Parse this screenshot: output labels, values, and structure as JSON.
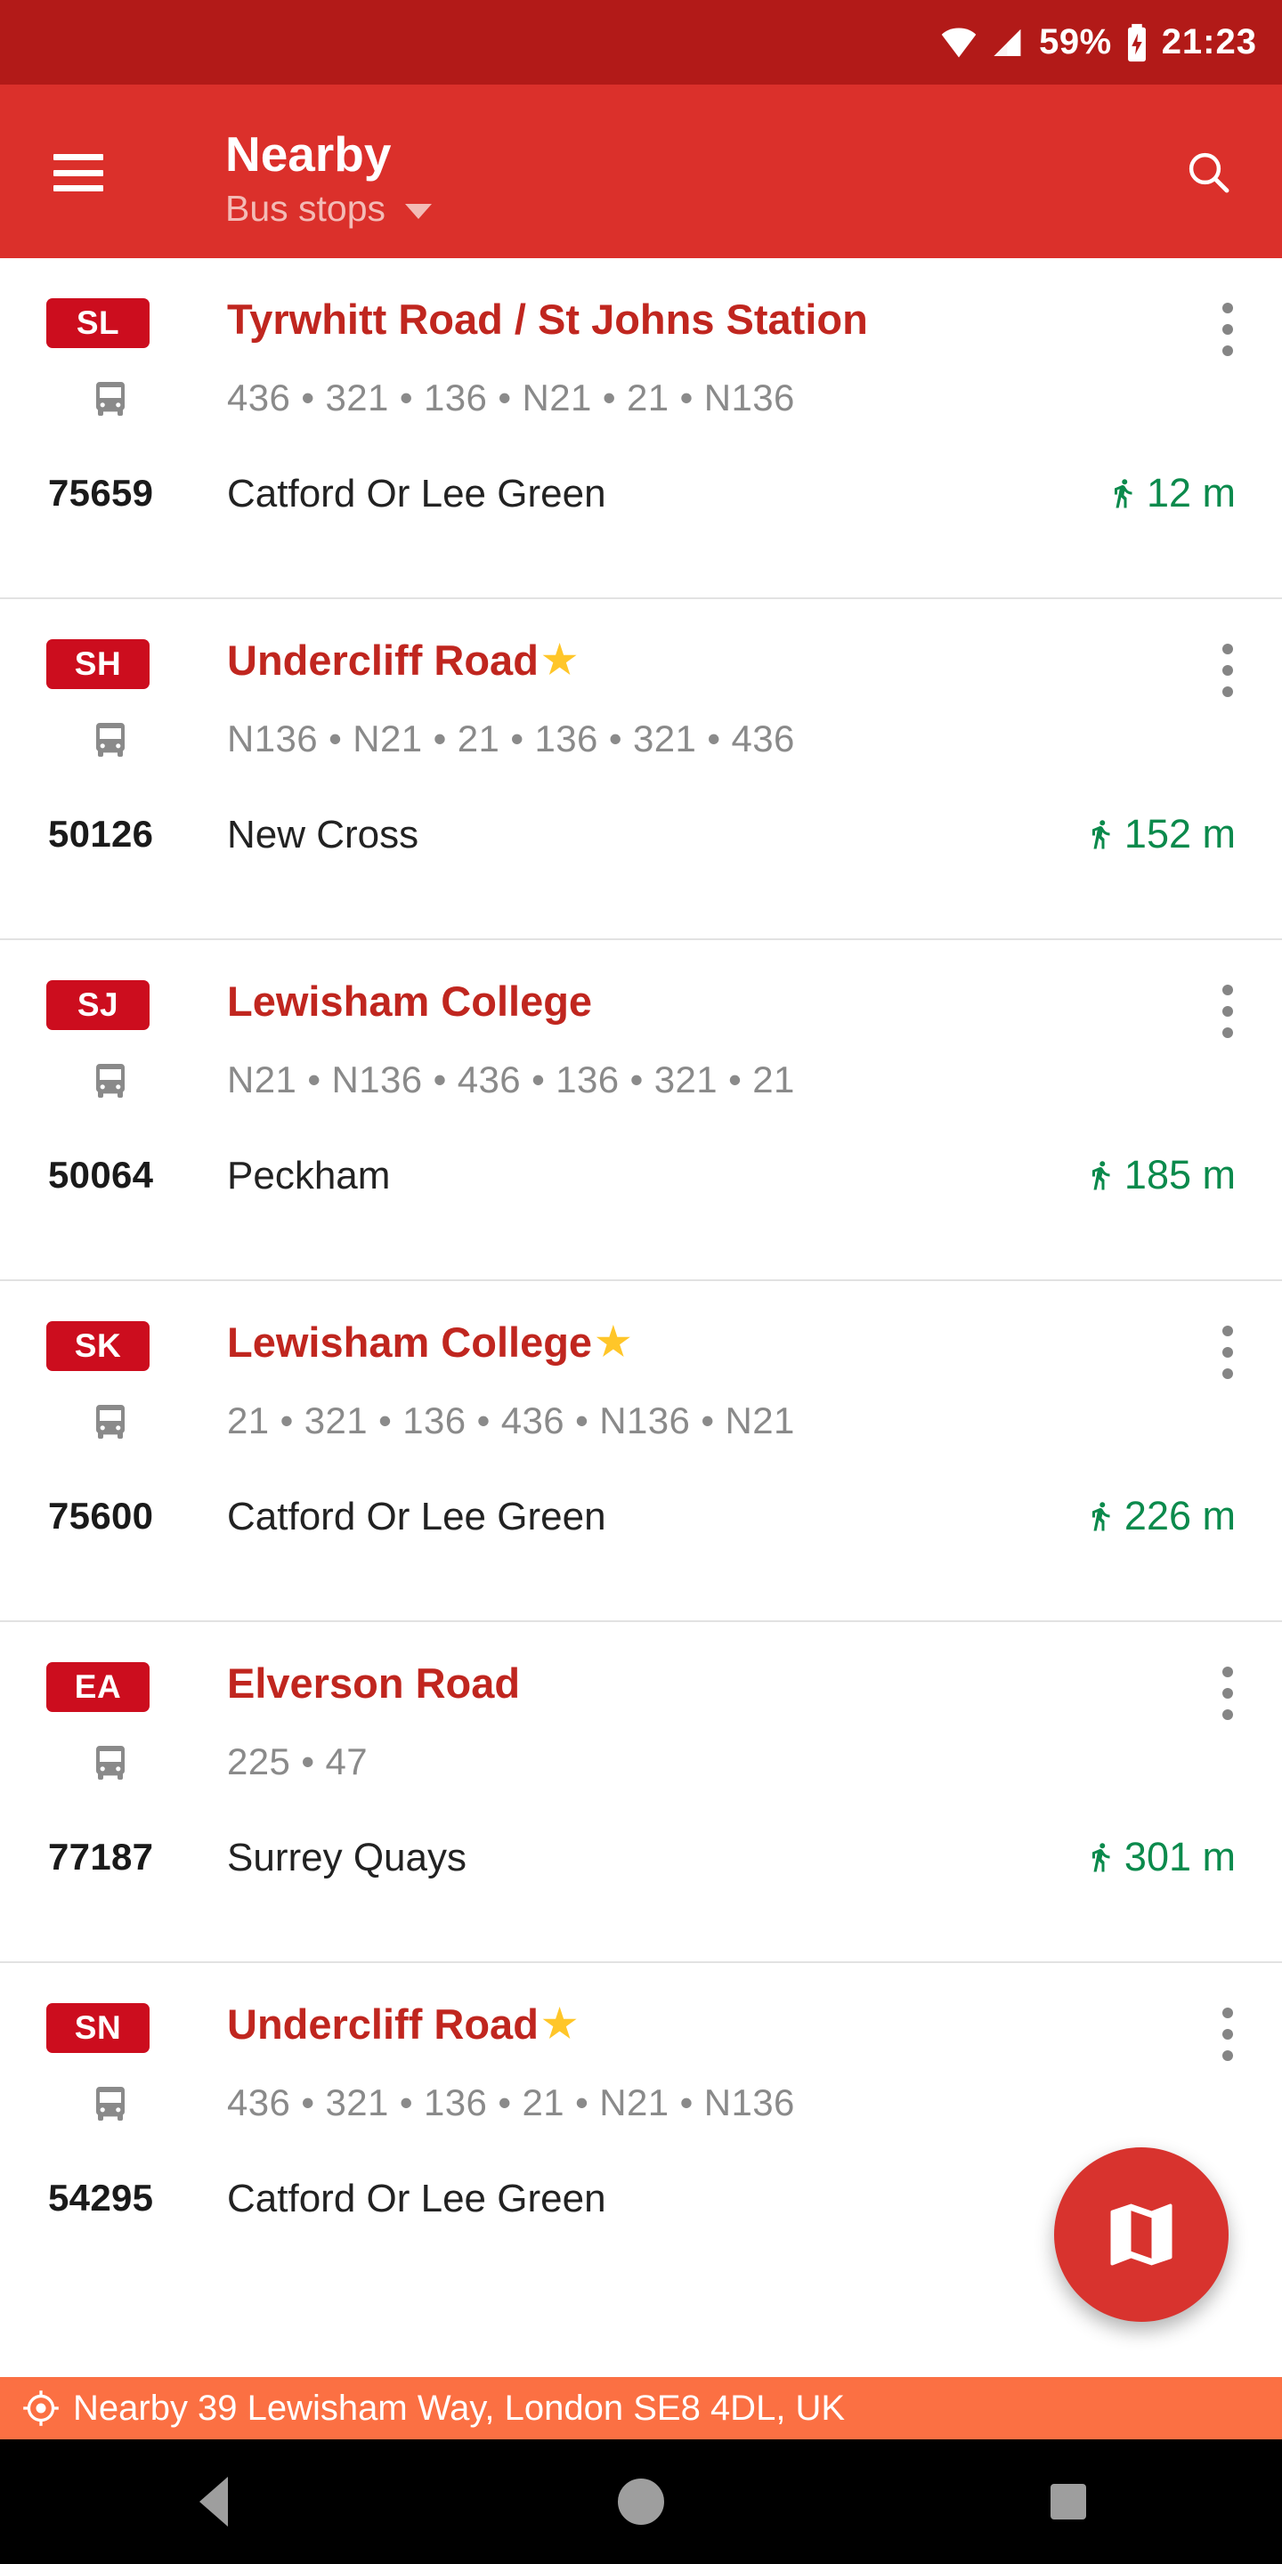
{
  "status_bar": {
    "wifi_icon": "wifi-icon",
    "signal_icon": "cellular-signal-icon",
    "battery_percent": "59%",
    "battery_icon": "battery-charging-icon",
    "time": "21:23"
  },
  "app_bar": {
    "menu_icon": "hamburger-menu-icon",
    "title": "Nearby",
    "subtitle": "Bus stops",
    "dropdown_icon": "chevron-down-icon",
    "search_icon": "search-icon"
  },
  "colors": {
    "status_bar": "#B21A18",
    "app_bar": "#DB302B",
    "badge": "#CC0D1E",
    "stop_name": "#C0261F",
    "distance": "#0B8A4C",
    "routes": "#8A8A8A",
    "location_bar": "#FB7043",
    "fab": "#D8332E",
    "star": "#FFC629"
  },
  "list": {
    "items": [
      {
        "badge": "SL",
        "name": "Tyrwhitt Road / St Johns Station",
        "favourite": false,
        "star": "",
        "routes": "436 • 321 • 136 • N21 • 21 • N136",
        "code": "75659",
        "destination": "Catford Or Lee Green",
        "distance": "12 m"
      },
      {
        "badge": "SH",
        "name": "Undercliff Road",
        "favourite": true,
        "star": "★",
        "routes": "N136 • N21 • 21 • 136 • 321 • 436",
        "code": "50126",
        "destination": "New Cross",
        "distance": "152 m"
      },
      {
        "badge": "SJ",
        "name": "Lewisham College",
        "favourite": false,
        "star": "",
        "routes": "N21 • N136 • 436 • 136 • 321 • 21",
        "code": "50064",
        "destination": "Peckham",
        "distance": "185 m"
      },
      {
        "badge": "SK",
        "name": "Lewisham College",
        "favourite": true,
        "star": "★",
        "routes": "21 • 321 • 136 • 436 • N136 • N21",
        "code": "75600",
        "destination": "Catford Or Lee Green",
        "distance": "226 m"
      },
      {
        "badge": "EA",
        "name": "Elverson Road",
        "favourite": false,
        "star": "",
        "routes": "225 • 47",
        "code": "77187",
        "destination": "Surrey Quays",
        "distance": "301 m"
      },
      {
        "badge": "SN",
        "name": "Undercliff Road",
        "favourite": true,
        "star": "★",
        "routes": "436 • 321 • 136 • 21 • N21 • N136",
        "code": "54295",
        "destination": "Catford Or Lee Green",
        "distance": ""
      }
    ],
    "bus_icon": "bus-icon",
    "overflow_icon": "overflow-menu-icon",
    "walk_icon": "walking-person-icon"
  },
  "fab": {
    "icon": "map-icon",
    "label": "Map"
  },
  "location_bar": {
    "icon": "gps-crosshair-icon",
    "text": "Nearby 39 Lewisham Way, London SE8 4DL, UK"
  },
  "nav_bar": {
    "back": "back-icon",
    "home": "home-icon",
    "recents": "recents-icon"
  }
}
